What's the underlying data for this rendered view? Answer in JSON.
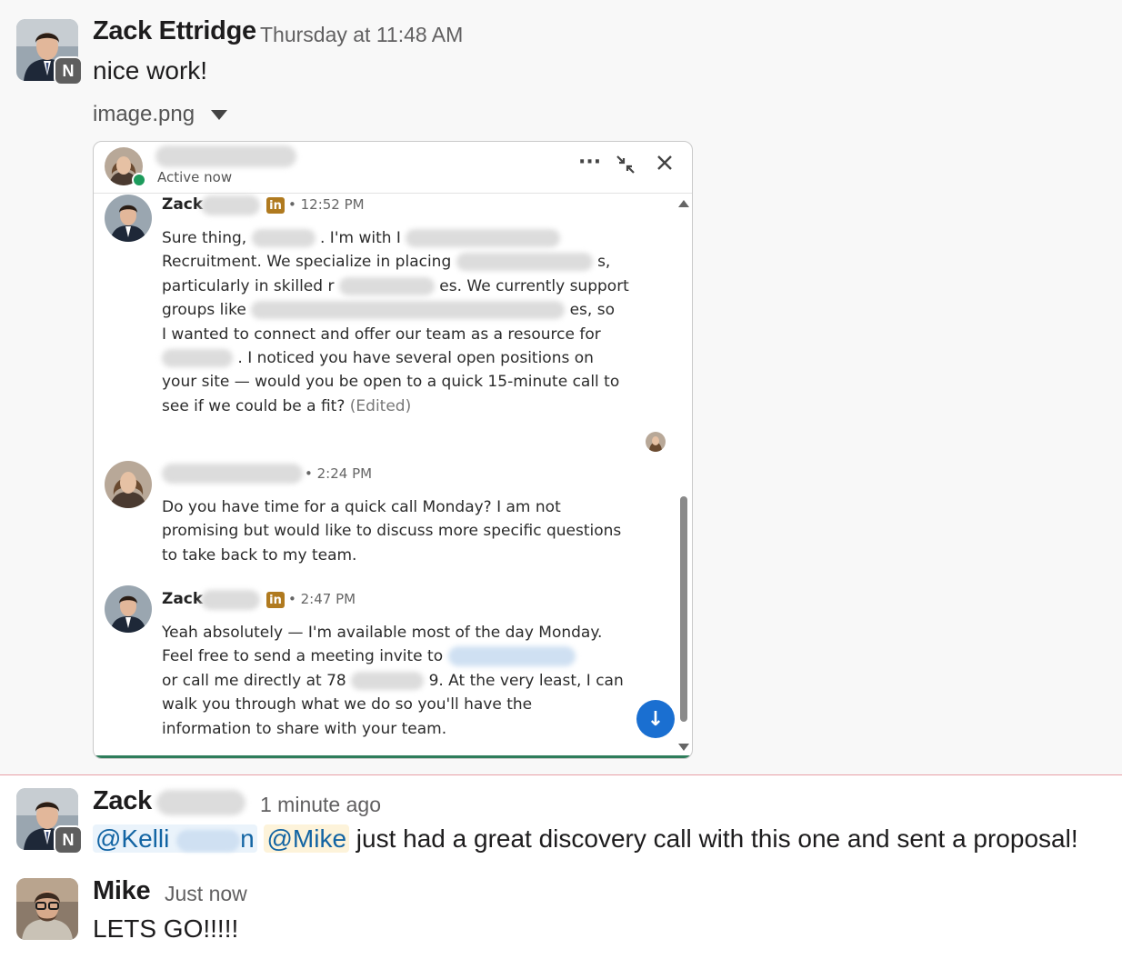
{
  "messages": [
    {
      "sender": "Zack Ettridge",
      "timestamp": "Thursday at 11:48 AM",
      "text": "nice work!",
      "badge": "N",
      "attachment": {
        "filename": "image.png",
        "screenshot": {
          "header_status": "Active now",
          "header_icons": [
            "more-icon",
            "minimize-icon",
            "close-icon"
          ],
          "conversation": [
            {
              "name": "Zack",
              "badge": "in",
              "time": "• 12:52 PM",
              "lines": [
                [
                  "Sure thing, ",
                  ". I'm with I"
                ],
                [
                  "Recruitment. We specialize in placing ",
                  "s,"
                ],
                [
                  "particularly in skilled r",
                  "es. We currently support"
                ],
                [
                  "groups like ",
                  "es, so"
                ],
                [
                  "I wanted to connect and offer our team as a resource for"
                ],
                [
                  "",
                  ". I noticed you have several open positions on"
                ],
                [
                  "your site — would you be open to a quick 15-minute call to"
                ],
                [
                  "see if we could be a fit? "
                ]
              ],
              "edited": "(Edited)"
            },
            {
              "name": "",
              "time": "• 2:24 PM",
              "lines": [
                [
                  "Do you have time for a quick call Monday? I am not"
                ],
                [
                  "promising but would like to discuss more specific questions"
                ],
                [
                  "to take back to my team."
                ]
              ]
            },
            {
              "name": "Zack",
              "badge": "in",
              "time": "• 2:47 PM",
              "lines": [
                [
                  "Yeah absolutely — I'm available most of the day Monday."
                ],
                [
                  "Feel free to send a meeting invite to "
                ],
                [
                  " or call me directly at 78",
                  "9. At the very least, I can"
                ],
                [
                  "walk you through what we do so you'll have the"
                ],
                [
                  "information to share with your team."
                ]
              ]
            }
          ]
        }
      }
    },
    {
      "sender": "Zack",
      "timestamp": "1 minute ago",
      "badge": "N",
      "mention1": "@Kelli",
      "mention1_tail": "n",
      "mention2": "@Mike",
      "text": " just had a great discovery call with this one and sent a proposal!"
    },
    {
      "sender": "Mike",
      "timestamp": "Just now",
      "text": "LETS GO!!!!!"
    }
  ],
  "colors": {
    "mention_text": "#1264a3",
    "new_messages_divider": "#e8a0a6",
    "online_dot": "#1d9b5c",
    "jump_button": "#1a6fd1"
  }
}
